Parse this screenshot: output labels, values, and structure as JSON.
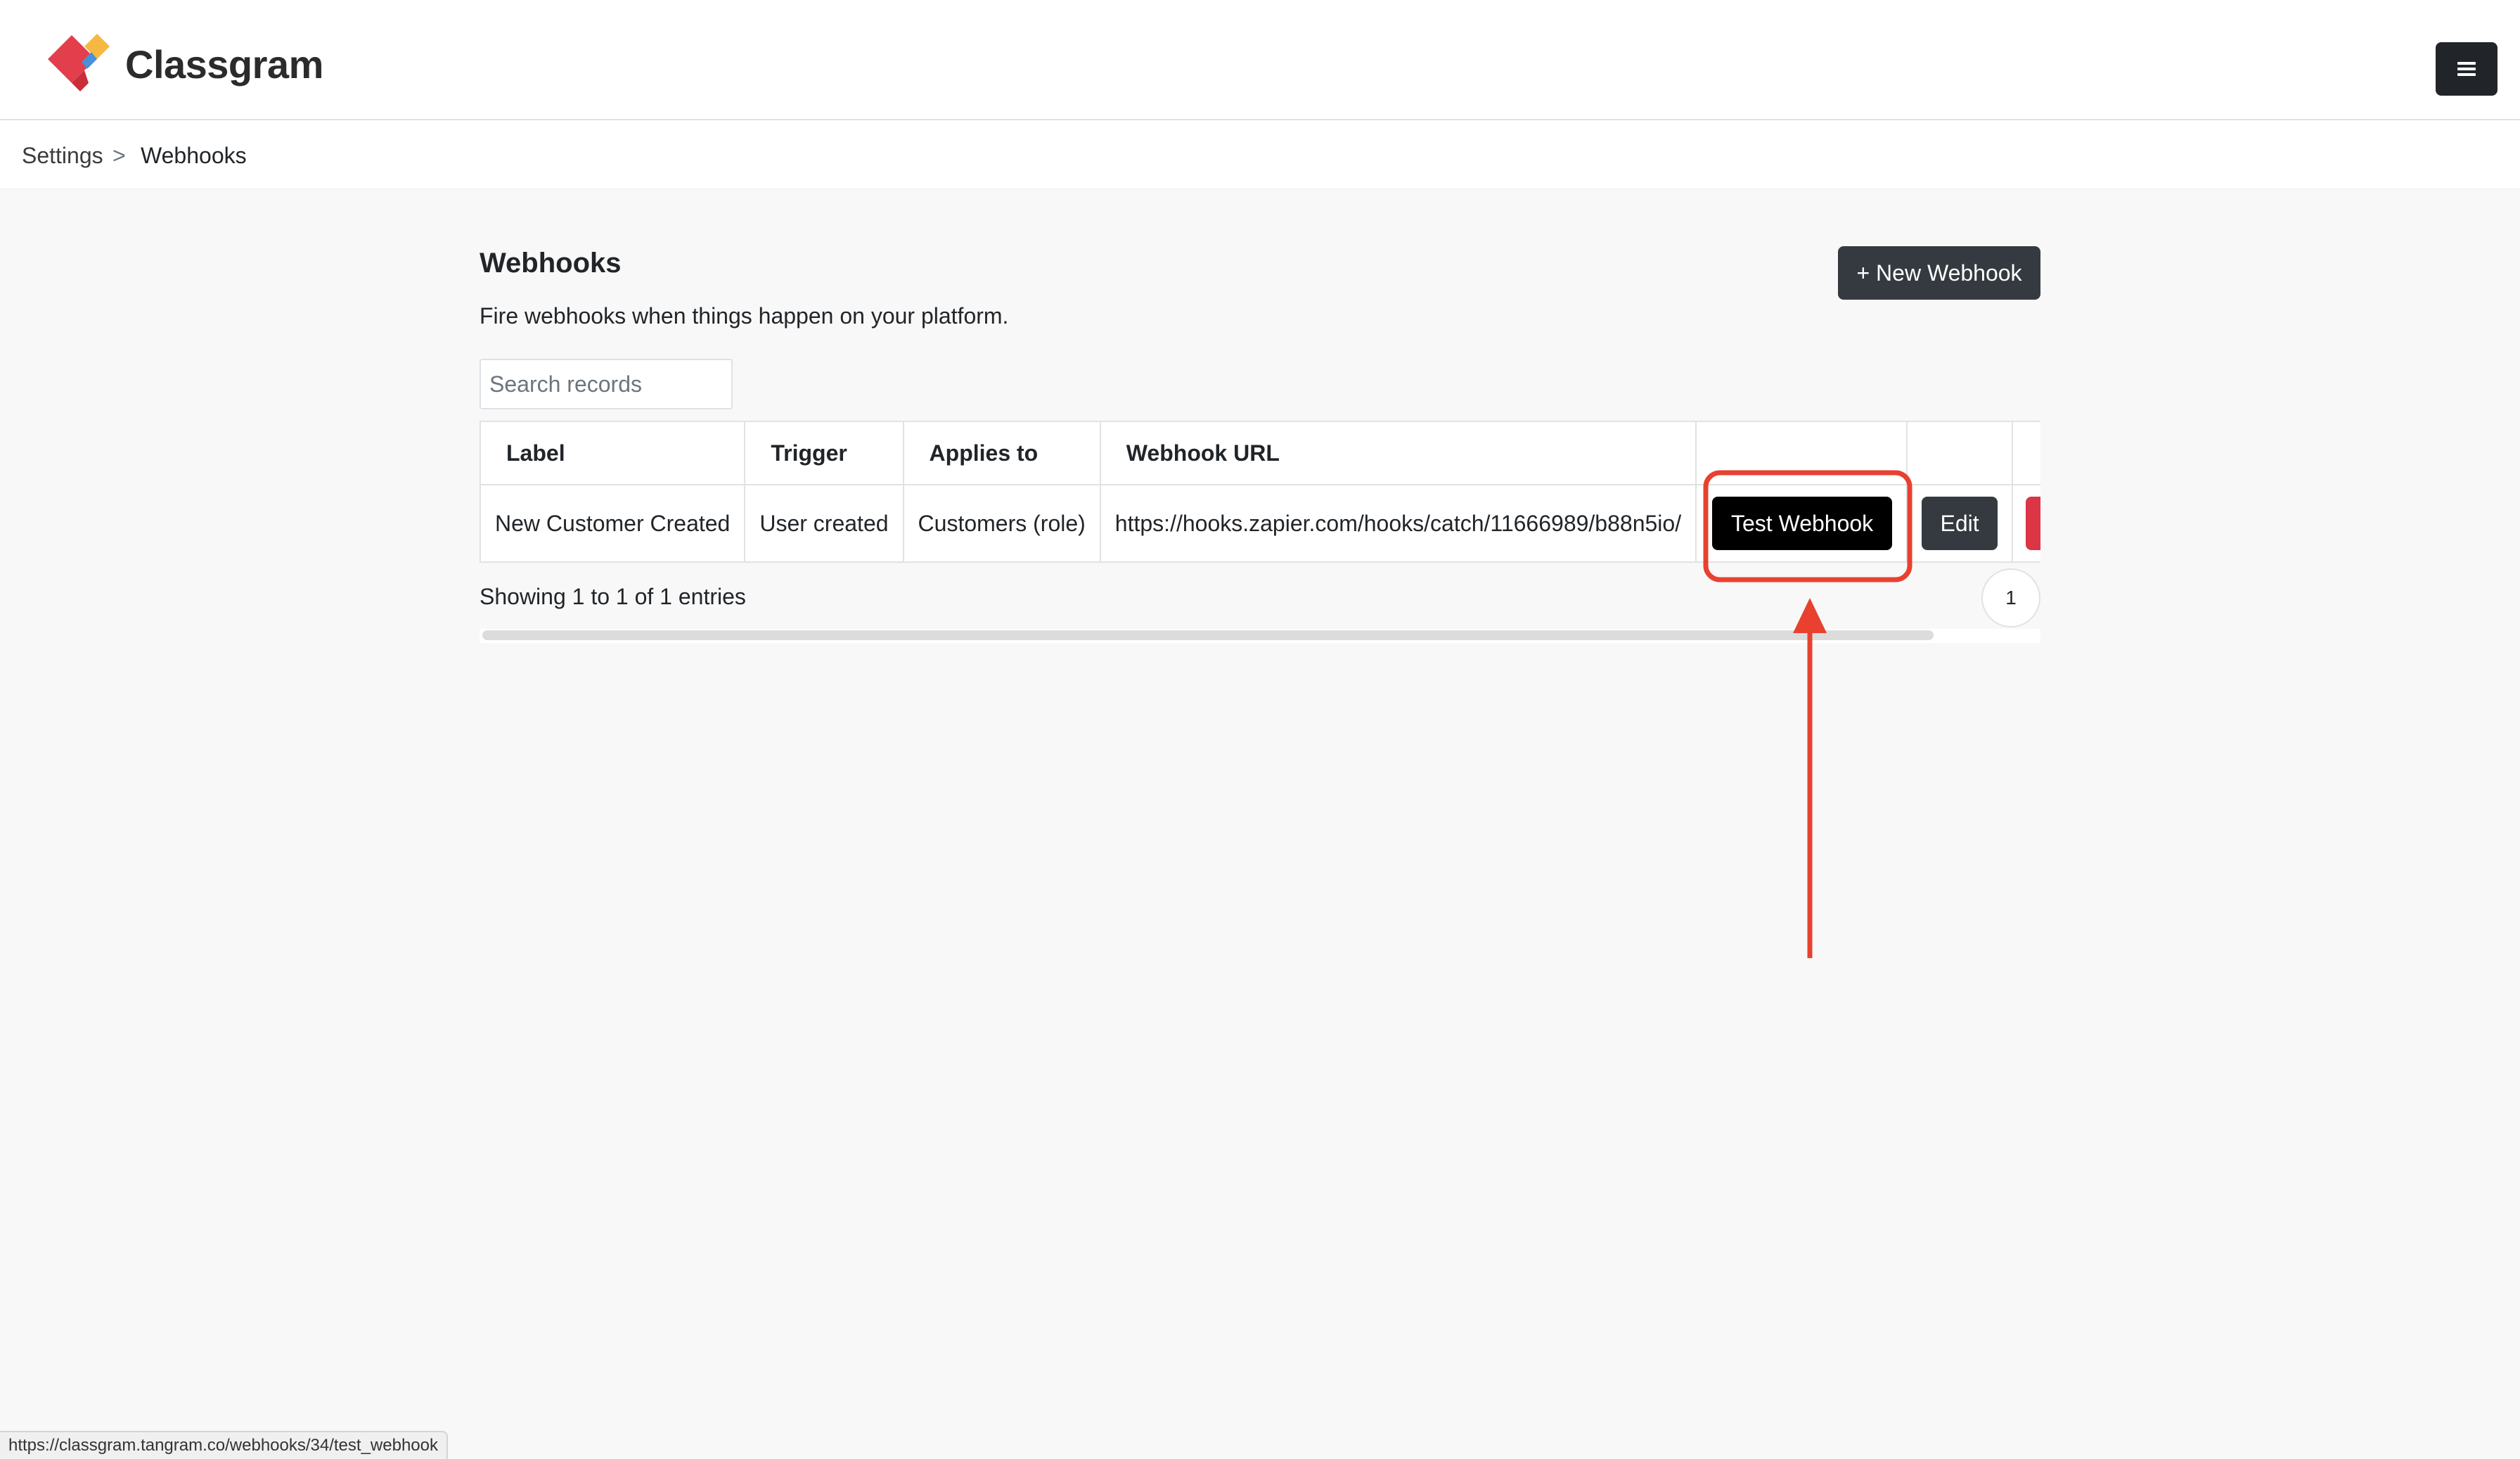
{
  "header": {
    "brand": "Classgram",
    "menu_icon": "hamburger-menu-icon"
  },
  "breadcrumb": {
    "items": [
      "Settings",
      "Webhooks"
    ],
    "separator": ">"
  },
  "main": {
    "title": "Webhooks",
    "subtitle": "Fire webhooks when things happen on your platform.",
    "new_button": "+ New Webhook",
    "search_placeholder": "Search records",
    "table": {
      "columns": [
        "Label",
        "Trigger",
        "Applies to",
        "Webhook URL",
        "",
        "",
        ""
      ],
      "rows": [
        {
          "label": "New Customer Created",
          "trigger": "User created",
          "applies_to": "Customers (role)",
          "url": "https://hooks.zapier.com/hooks/catch/11666989/b88n5io/",
          "test_button": "Test Webhook",
          "edit_button": "Edit"
        }
      ]
    },
    "showing": "Showing 1 to 1 of 1 entries",
    "pagination": [
      "1"
    ]
  },
  "statusbar": {
    "url": "https://classgram.tangram.co/webhooks/34/test_webhook"
  },
  "colors": {
    "accent_dark": "#343a40",
    "annotation_red": "#e8412f",
    "logo_red": "#e23e4c",
    "logo_yellow": "#f5b942",
    "logo_blue": "#4a90d9"
  }
}
